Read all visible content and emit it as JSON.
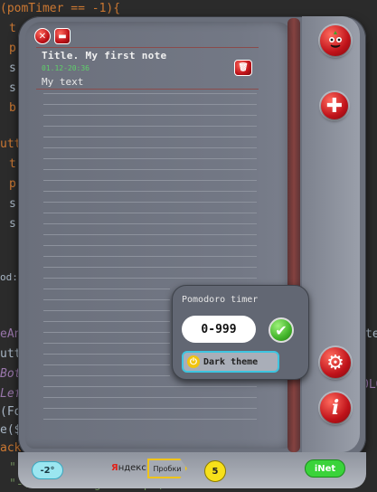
{
  "background_code": {
    "lines": [
      "(pomTimer == -1){",
      "t",
      "p",
      "s",
      "s",
      "b",
      "utto",
      "t",
      "p",
      "s",
      "s",
      "od:",
      "eAn",
      "utt",
      "Bot",
      "Lef",
      "(Fo",
      "e($",
      "ack",
      "\"",
      "\"-fx-min-height: 17px;\" +"
    ],
    "right_fragments": [
      "te",
      "OLO"
    ]
  },
  "note": {
    "title": "Title. My first note",
    "date": "01.12-20:36",
    "text": "My text"
  },
  "icons": {
    "close": "close-icon",
    "minimize": "minimize-icon",
    "tomato": "tomato-icon",
    "add": "add-icon",
    "settings": "gears-icon",
    "info": "info-icon",
    "note_delete": "trash-icon"
  },
  "pomodoro": {
    "title": "Pomodoro timer",
    "input_value": "0-999",
    "ok_icon": "check-icon",
    "dark_theme_label": "Dark theme",
    "power_icon": "power-icon"
  },
  "status_bar": {
    "temperature": "-2°",
    "yandex_prefix": "Я",
    "yandex_rest": "ндекс",
    "traffic_label": "Пробки",
    "traffic_level": "5",
    "inet_label": "iNet"
  },
  "colors": {
    "accent_red": "#c0131a",
    "accent_green": "#41b32a",
    "date_green": "#5fd06a",
    "temp_cyan": "#9be6f0",
    "traffic_yellow": "#f7e01a"
  }
}
